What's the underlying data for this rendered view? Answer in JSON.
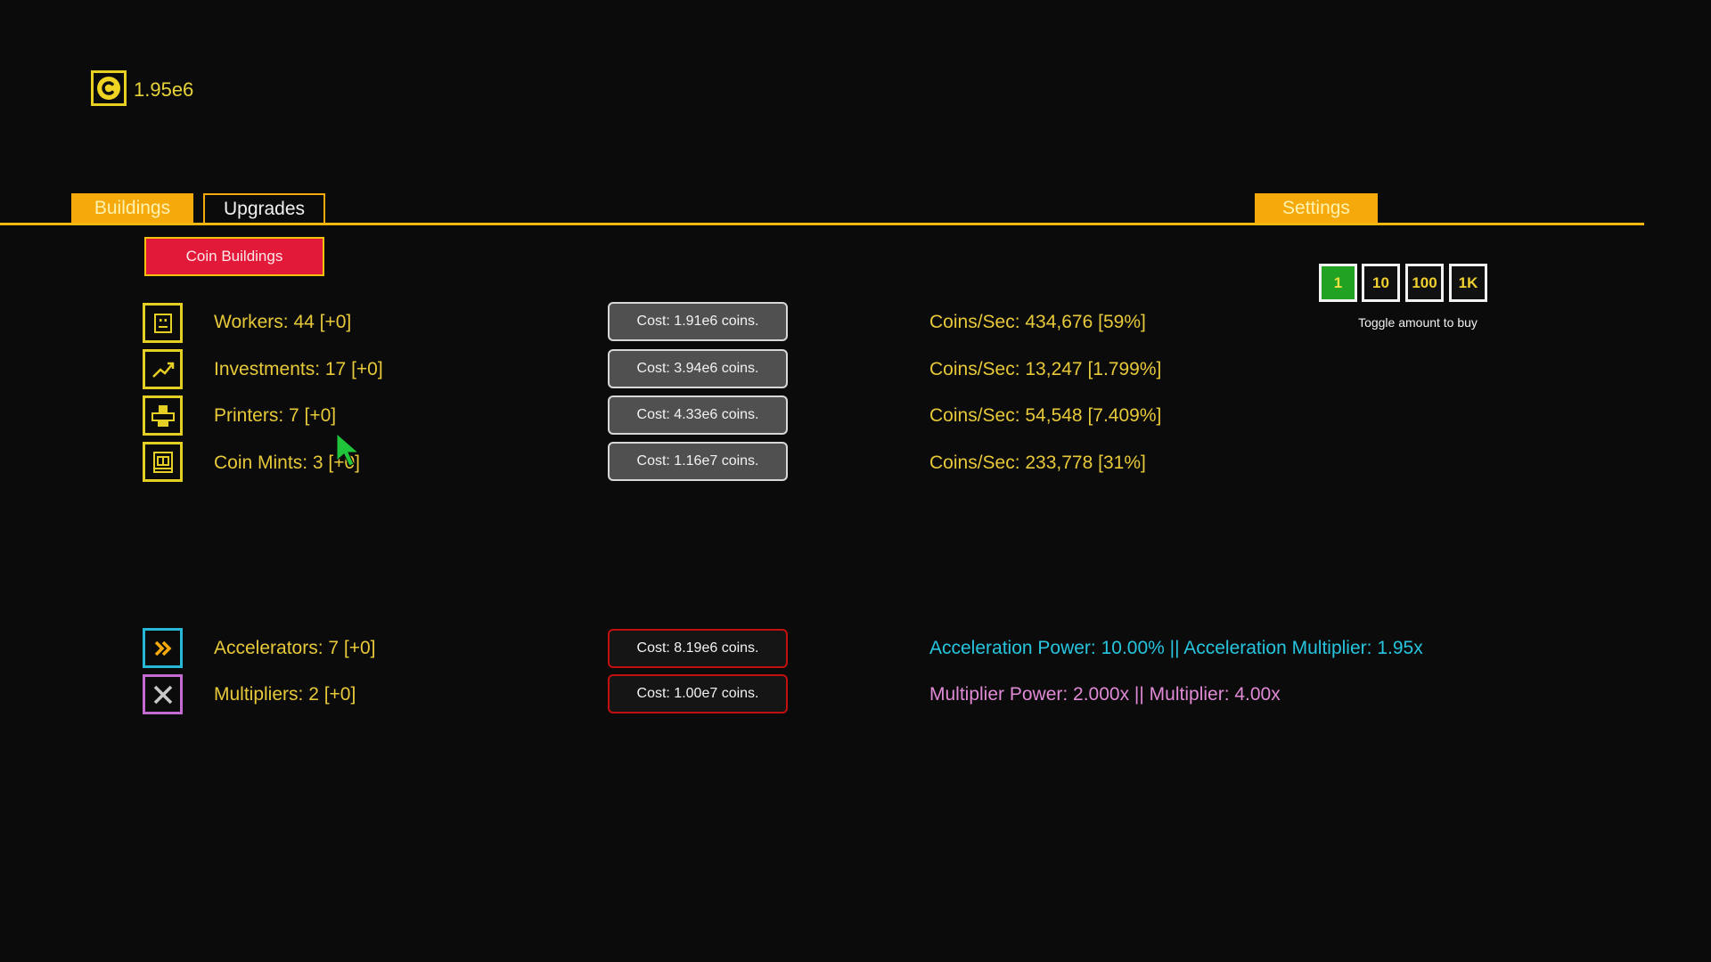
{
  "coins": {
    "icon": "coin-icon",
    "amount": "1.95e6"
  },
  "tabs": [
    {
      "label": "Buildings",
      "active": true
    },
    {
      "label": "Upgrades",
      "active": false
    },
    {
      "label": "Settings",
      "active": true
    }
  ],
  "sub_tab": {
    "label": "Coin Buildings"
  },
  "amount_toggle": {
    "options": [
      "1",
      "10",
      "100",
      "1K"
    ],
    "selected": "1",
    "hint": "Toggle amount to buy"
  },
  "buildings": [
    {
      "icon": "worker-icon",
      "name": "Workers: 44 [+0]",
      "cost": "Cost: 1.91e6 coins.",
      "rate": "Coins/Sec: 434,676 [59%]"
    },
    {
      "icon": "chart-trend-icon",
      "name": "Investments: 17 [+0]",
      "cost": "Cost: 3.94e6 coins.",
      "rate": "Coins/Sec: 13,247 [1.799%]"
    },
    {
      "icon": "printer-icon",
      "name": "Printers: 7 [+0]",
      "cost": "Cost: 4.33e6 coins.",
      "rate": "Coins/Sec: 54,548 [7.409%]"
    },
    {
      "icon": "coin-mint-icon",
      "name": "Coin Mints: 3 [+0]",
      "cost": "Cost: 1.16e7 coins.",
      "rate": "Coins/Sec: 233,778 [31%]"
    }
  ],
  "boosters": [
    {
      "icon": "double-chevron-right-icon",
      "name": "Accelerators: 7 [+0]",
      "cost": "Cost: 8.19e6 coins.",
      "rate": "Acceleration Power: 10.00% || Acceleration Multiplier: 1.95x"
    },
    {
      "icon": "multiply-x-icon",
      "name": "Multipliers: 2 [+0]",
      "cost": "Cost: 1.00e7 coins.",
      "rate": "Multiplier Power: 2.000x || Multiplier: 4.00x"
    }
  ],
  "colors": {
    "background": "#0b0b0b",
    "accent": "#f5a90a",
    "text_yellow": "#e7c93a",
    "subtab_red": "#e3193a",
    "toggle_green": "#22a222",
    "accelerator_cyan": "#27c5de",
    "multiplier_pink": "#e08ad6"
  }
}
